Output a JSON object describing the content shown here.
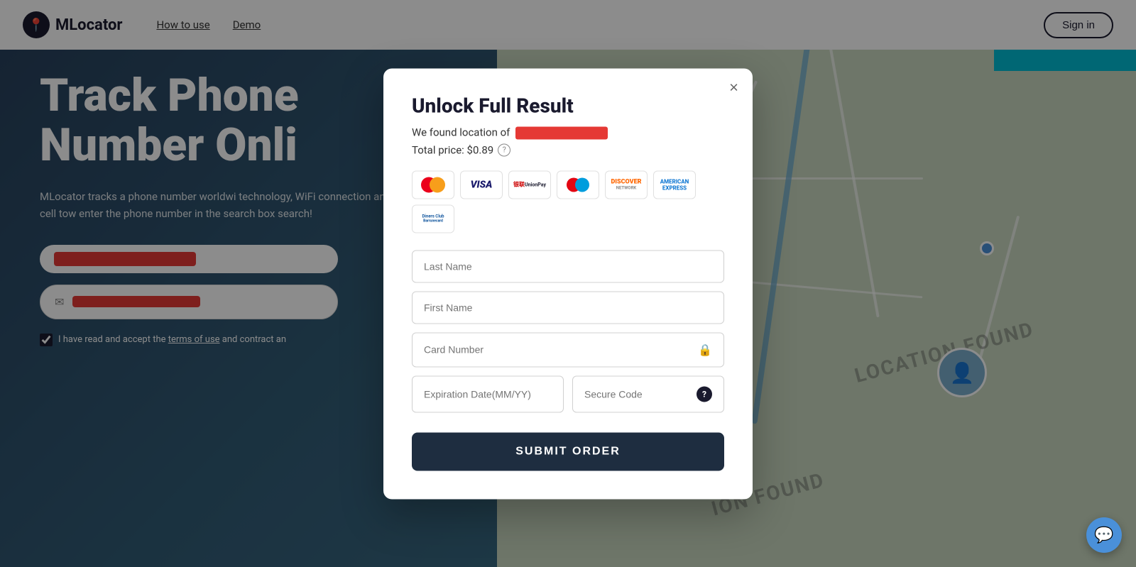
{
  "navbar": {
    "logo_text": "MLocator",
    "links": [
      "How to use",
      "Demo"
    ],
    "sign_in": "Sign in"
  },
  "hero": {
    "title": "Track Phone Number Onli",
    "description": "MLocator tracks a phone number worldwi technology, WiFi connection and cell tow enter the phone number in the search box search!",
    "terms_text": "I have read and accept the",
    "terms_link": "terms of use",
    "terms_suffix": "and contract an"
  },
  "map": {
    "location_found_1": "LOCATION FOUND",
    "location_found_2": "ION FOUND"
  },
  "modal": {
    "title": "Unlock Full Result",
    "subtitle": "We found location of",
    "price_label": "Total price: $0.89",
    "close_label": "×",
    "card_logos": [
      {
        "name": "mastercard",
        "label": "MC"
      },
      {
        "name": "visa",
        "label": "VISA"
      },
      {
        "name": "unionpay",
        "label": "UP"
      },
      {
        "name": "maestro",
        "label": "M"
      },
      {
        "name": "discover",
        "label": "DISCOVER"
      },
      {
        "name": "amex",
        "label": "AMERICAN EXPRESS"
      },
      {
        "name": "diners",
        "label": "Diners Club"
      }
    ],
    "fields": {
      "last_name_placeholder": "Last Name",
      "first_name_placeholder": "First Name",
      "card_number_placeholder": "Card Number",
      "expiry_placeholder": "Expiration Date(MM/YY)",
      "secure_code_placeholder": "Secure Code"
    },
    "submit_label": "SUBMIT ORDER"
  },
  "chat": {
    "icon": "💬"
  }
}
